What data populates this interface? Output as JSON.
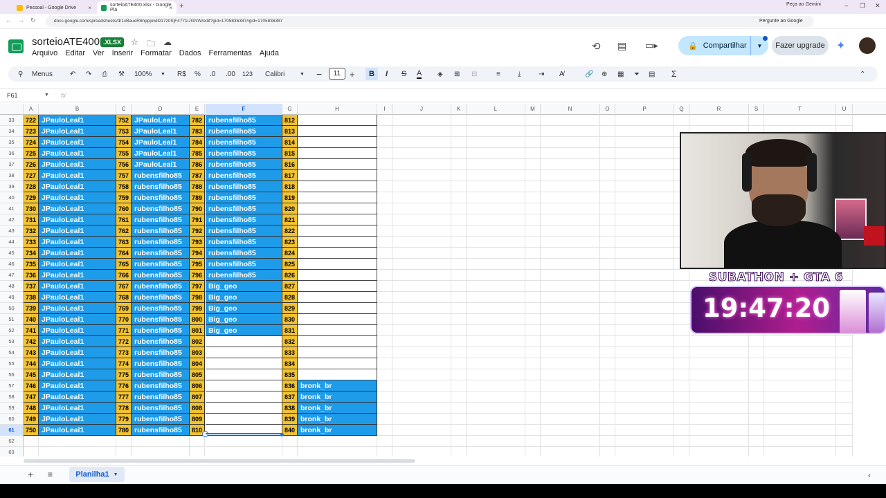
{
  "browser": {
    "tabs": [
      {
        "title": "Pessoal - Google Drive",
        "close": "×"
      },
      {
        "title": "sorteioATE400.xlsx - Google Pla",
        "close": "×"
      }
    ],
    "new_tab": "+",
    "gemini_label": "Peça ao Gemini",
    "window_controls": [
      "–",
      "❐",
      "✕"
    ],
    "url": "docs.google.com/spreadsheets/d/1xBaueR6hppjowlD17z0SjF4771IJGNW/edit?gid=1705836387#gid=1705836387",
    "ask_google": "Pergunte ao Google",
    "nav": [
      "←",
      "→",
      "↻"
    ]
  },
  "doc": {
    "title": "sorteioATE400",
    "badge": ".XLSX",
    "menus": [
      "Arquivo",
      "Editar",
      "Ver",
      "Inserir",
      "Formatar",
      "Dados",
      "Ferramentas",
      "Ajuda"
    ],
    "share_label": "Compartilhar",
    "upgrade_label": "Fazer upgrade"
  },
  "toolbar": {
    "menus_label": "Menus",
    "zoom": "100%",
    "currency": "R$",
    "percent": "%",
    "dec_minus": ".0",
    "dec_plus": ".00",
    "number_format": "123",
    "font": "Calibri",
    "font_size": "11",
    "bold": "B",
    "italic": "I",
    "strike": "S",
    "text_color": "A",
    "sum": "Σ"
  },
  "formula_bar": {
    "name_box": "F61",
    "fx": "fx",
    "content": ""
  },
  "columns": [
    "A",
    "B",
    "C",
    "D",
    "E",
    "F",
    "G",
    "H",
    "I",
    "J",
    "K",
    "L",
    "M",
    "N",
    "O",
    "P",
    "Q",
    "R",
    "S",
    "T",
    "U"
  ],
  "selected_column": "F",
  "selected_row": 61,
  "rows": [
    {
      "n": 33,
      "A": "722",
      "B": "JPauloLeal1",
      "C": "752",
      "D": "JPauloLeal1",
      "E": "782",
      "F": "rubensfilho85",
      "G": "812",
      "H": ""
    },
    {
      "n": 34,
      "A": "723",
      "B": "JPauloLeal1",
      "C": "753",
      "D": "JPauloLeal1",
      "E": "783",
      "F": "rubensfilho85",
      "G": "813",
      "H": ""
    },
    {
      "n": 35,
      "A": "724",
      "B": "JPauloLeal1",
      "C": "754",
      "D": "JPauloLeal1",
      "E": "784",
      "F": "rubensfilho85",
      "G": "814",
      "H": ""
    },
    {
      "n": 36,
      "A": "725",
      "B": "JPauloLeal1",
      "C": "755",
      "D": "JPauloLeal1",
      "E": "785",
      "F": "rubensfilho85",
      "G": "815",
      "H": ""
    },
    {
      "n": 37,
      "A": "726",
      "B": "JPauloLeal1",
      "C": "756",
      "D": "JPauloLeal1",
      "E": "786",
      "F": "rubensfilho85",
      "G": "816",
      "H": ""
    },
    {
      "n": 38,
      "A": "727",
      "B": "JPauloLeal1",
      "C": "757",
      "D": "rubensfilho85",
      "E": "787",
      "F": "rubensfilho85",
      "G": "817",
      "H": ""
    },
    {
      "n": 39,
      "A": "728",
      "B": "JPauloLeal1",
      "C": "758",
      "D": "rubensfilho85",
      "E": "788",
      "F": "rubensfilho85",
      "G": "818",
      "H": ""
    },
    {
      "n": 40,
      "A": "729",
      "B": "JPauloLeal1",
      "C": "759",
      "D": "rubensfilho85",
      "E": "789",
      "F": "rubensfilho85",
      "G": "819",
      "H": ""
    },
    {
      "n": 41,
      "A": "730",
      "B": "JPauloLeal1",
      "C": "760",
      "D": "rubensfilho85",
      "E": "790",
      "F": "rubensfilho85",
      "G": "820",
      "H": ""
    },
    {
      "n": 42,
      "A": "731",
      "B": "JPauloLeal1",
      "C": "761",
      "D": "rubensfilho85",
      "E": "791",
      "F": "rubensfilho85",
      "G": "821",
      "H": ""
    },
    {
      "n": 43,
      "A": "732",
      "B": "JPauloLeal1",
      "C": "762",
      "D": "rubensfilho85",
      "E": "792",
      "F": "rubensfilho85",
      "G": "822",
      "H": ""
    },
    {
      "n": 44,
      "A": "733",
      "B": "JPauloLeal1",
      "C": "763",
      "D": "rubensfilho85",
      "E": "793",
      "F": "rubensfilho85",
      "G": "823",
      "H": ""
    },
    {
      "n": 45,
      "A": "734",
      "B": "JPauloLeal1",
      "C": "764",
      "D": "rubensfilho85",
      "E": "794",
      "F": "rubensfilho85",
      "G": "824",
      "H": ""
    },
    {
      "n": 46,
      "A": "735",
      "B": "JPauloLeal1",
      "C": "765",
      "D": "rubensfilho85",
      "E": "795",
      "F": "rubensfilho85",
      "G": "825",
      "H": ""
    },
    {
      "n": 47,
      "A": "736",
      "B": "JPauloLeal1",
      "C": "766",
      "D": "rubensfilho85",
      "E": "796",
      "F": "rubensfilho85",
      "G": "826",
      "H": ""
    },
    {
      "n": 48,
      "A": "737",
      "B": "JPauloLeal1",
      "C": "767",
      "D": "rubensfilho85",
      "E": "797",
      "F": "Big_geo",
      "G": "827",
      "H": ""
    },
    {
      "n": 49,
      "A": "738",
      "B": "JPauloLeal1",
      "C": "768",
      "D": "rubensfilho85",
      "E": "798",
      "F": "Big_geo",
      "G": "828",
      "H": ""
    },
    {
      "n": 50,
      "A": "739",
      "B": "JPauloLeal1",
      "C": "769",
      "D": "rubensfilho85",
      "E": "799",
      "F": "Big_geo",
      "G": "829",
      "H": ""
    },
    {
      "n": 51,
      "A": "740",
      "B": "JPauloLeal1",
      "C": "770",
      "D": "rubensfilho85",
      "E": "800",
      "F": "Big_geo",
      "G": "830",
      "H": ""
    },
    {
      "n": 52,
      "A": "741",
      "B": "JPauloLeal1",
      "C": "771",
      "D": "rubensfilho85",
      "E": "801",
      "F": "Big_geo",
      "G": "831",
      "H": ""
    },
    {
      "n": 53,
      "A": "742",
      "B": "JPauloLeal1",
      "C": "772",
      "D": "rubensfilho85",
      "E": "802",
      "F": "",
      "G": "832",
      "H": ""
    },
    {
      "n": 54,
      "A": "743",
      "B": "JPauloLeal1",
      "C": "773",
      "D": "rubensfilho85",
      "E": "803",
      "F": "",
      "G": "833",
      "H": ""
    },
    {
      "n": 55,
      "A": "744",
      "B": "JPauloLeal1",
      "C": "774",
      "D": "rubensfilho85",
      "E": "804",
      "F": "",
      "G": "834",
      "H": ""
    },
    {
      "n": 56,
      "A": "745",
      "B": "JPauloLeal1",
      "C": "775",
      "D": "rubensfilho85",
      "E": "805",
      "F": "",
      "G": "835",
      "H": ""
    },
    {
      "n": 57,
      "A": "746",
      "B": "JPauloLeal1",
      "C": "776",
      "D": "rubensfilho85",
      "E": "806",
      "F": "",
      "G": "836",
      "H": "bronk_br"
    },
    {
      "n": 58,
      "A": "747",
      "B": "JPauloLeal1",
      "C": "777",
      "D": "rubensfilho85",
      "E": "807",
      "F": "",
      "G": "837",
      "H": "bronk_br"
    },
    {
      "n": 59,
      "A": "748",
      "B": "JPauloLeal1",
      "C": "778",
      "D": "rubensfilho85",
      "E": "808",
      "F": "",
      "G": "838",
      "H": "bronk_br"
    },
    {
      "n": 60,
      "A": "749",
      "B": "JPauloLeal1",
      "C": "779",
      "D": "rubensfilho85",
      "E": "809",
      "F": "",
      "G": "839",
      "H": "bronk_br"
    },
    {
      "n": 61,
      "A": "750",
      "B": "JPauloLeal1",
      "C": "780",
      "D": "rubensfilho85",
      "E": "810",
      "F": "",
      "G": "840",
      "H": "bronk_br"
    },
    {
      "n": 62
    },
    {
      "n": 63
    }
  ],
  "overlay": {
    "subathon_title": "SUBATHON + GTA 6",
    "timer": "19:47:20"
  },
  "sheets": {
    "active": "Planilha1",
    "add": "+",
    "list": "≡"
  },
  "colors": {
    "yellow": "#f1c232",
    "blue": "#1e9be9",
    "accent": "#0b57d0"
  }
}
